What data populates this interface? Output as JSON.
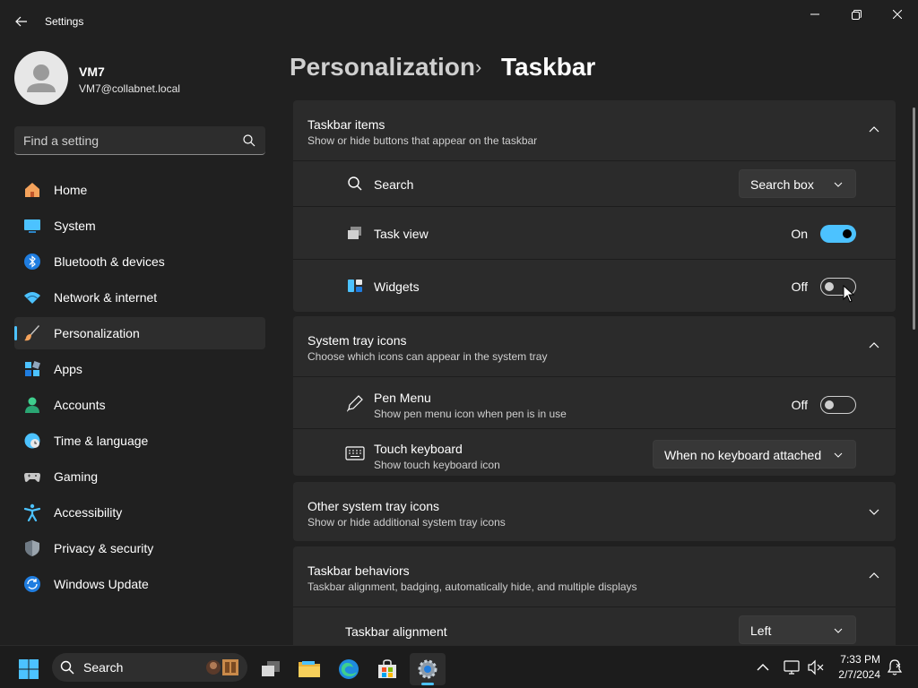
{
  "window": {
    "app_title": "Settings",
    "back_icon": "arrow-left-icon",
    "controls": [
      "minimize-icon",
      "restore-icon",
      "close-icon"
    ]
  },
  "profile": {
    "name": "VM7",
    "email": "VM7@collabnet.local"
  },
  "search": {
    "placeholder": "Find a setting",
    "icon": "search-icon"
  },
  "sidebar": {
    "active": "Personalization",
    "items": [
      {
        "label": "Home",
        "icon": "home-icon"
      },
      {
        "label": "System",
        "icon": "monitor-icon"
      },
      {
        "label": "Bluetooth & devices",
        "icon": "bluetooth-icon"
      },
      {
        "label": "Network & internet",
        "icon": "wifi-icon"
      },
      {
        "label": "Personalization",
        "icon": "paintbrush-icon"
      },
      {
        "label": "Apps",
        "icon": "apps-icon"
      },
      {
        "label": "Accounts",
        "icon": "person-icon"
      },
      {
        "label": "Time & language",
        "icon": "globe-clock-icon"
      },
      {
        "label": "Gaming",
        "icon": "gamepad-icon"
      },
      {
        "label": "Accessibility",
        "icon": "accessibility-icon"
      },
      {
        "label": "Privacy & security",
        "icon": "shield-icon"
      },
      {
        "label": "Windows Update",
        "icon": "update-icon"
      }
    ]
  },
  "breadcrumb": {
    "parent": "Personalization",
    "separator": "›",
    "current": "Taskbar"
  },
  "sections": {
    "taskbar_items": {
      "title": "Taskbar items",
      "subtitle": "Show or hide buttons that appear on the taskbar",
      "expanded": true,
      "search": {
        "label": "Search",
        "value": "Search box"
      },
      "task_view": {
        "label": "Task view",
        "state": "On"
      },
      "widgets": {
        "label": "Widgets",
        "state": "Off"
      }
    },
    "system_tray": {
      "title": "System tray icons",
      "subtitle": "Choose which icons can appear in the system tray",
      "expanded": true,
      "pen_menu": {
        "label": "Pen Menu",
        "sub": "Show pen menu icon when pen is in use",
        "state": "Off"
      },
      "touch_keyboard": {
        "label": "Touch keyboard",
        "sub": "Show touch keyboard icon",
        "value": "When no keyboard attached"
      }
    },
    "other_tray": {
      "title": "Other system tray icons",
      "subtitle": "Show or hide additional system tray icons",
      "expanded": false
    },
    "behaviors": {
      "title": "Taskbar behaviors",
      "subtitle": "Taskbar alignment, badging, automatically hide, and multiple displays",
      "expanded": true,
      "alignment": {
        "label": "Taskbar alignment",
        "value": "Left"
      }
    }
  },
  "taskbar": {
    "search_label": "Search",
    "apps": [
      "task-view-icon",
      "file-explorer-icon",
      "edge-icon",
      "store-icon",
      "settings-icon"
    ],
    "active_app": "settings-icon",
    "time": "7:33 PM",
    "date": "2/7/2024"
  },
  "colors": {
    "accent": "#4cc2ff",
    "background": "#202020",
    "card": "#2b2b2b"
  }
}
